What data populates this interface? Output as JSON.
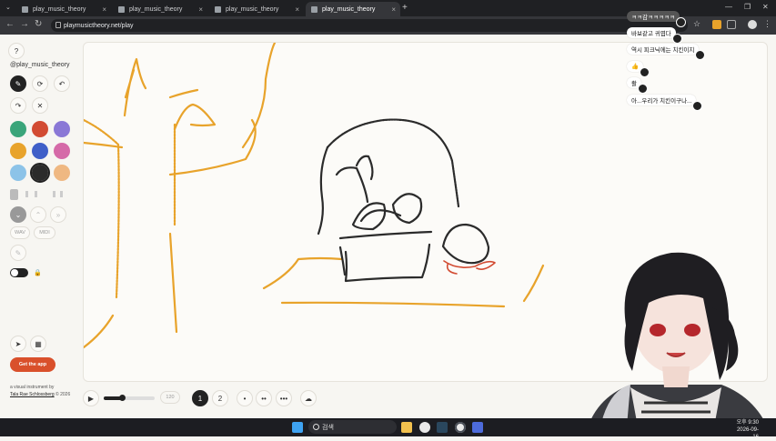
{
  "browser": {
    "tabs": [
      {
        "title": "play_music_theory"
      },
      {
        "title": "play_music_theory"
      },
      {
        "title": "play_music_theory"
      },
      {
        "title": "play_music_theory"
      }
    ],
    "url": "playmusictheory.net/play"
  },
  "sidebar": {
    "handle": "@play_music_theory",
    "help_glyph": "?",
    "tool_glyphs": {
      "pen": "✎",
      "shuffle": "⟳",
      "undo": "↶",
      "redo": "↷",
      "random": "✕"
    },
    "colors": [
      "#3aa57a",
      "#d24b32",
      "#8a78d6",
      "#e8a32b",
      "#3f5fc8",
      "#d56aa8",
      "#8cc3e8",
      "#2b2b2b",
      "#efb882"
    ],
    "selected_color": "#2b2b2b",
    "wav_label": "WAV",
    "midi_label": "MIDI",
    "get_app_label": "Get the app",
    "credit_prefix": "a visual instrument by",
    "credit_author": "Tala Rae Schlossberg",
    "credit_year": "© 2026"
  },
  "playback": {
    "tempo": "120",
    "page_1": "1",
    "page_2": "2",
    "dot1": "•",
    "dot2": "••",
    "dot3": "•••",
    "progress": 0.35
  },
  "chat": [
    {
      "text": "ㅋㅋ감ㅋㅋㅋㅋㅋ",
      "dark": true
    },
    {
      "text": "바보같고 귀엽다",
      "dark": false
    },
    {
      "text": "역시 피크닉에는 치킨이지",
      "dark": false
    },
    {
      "text": "👍",
      "dark": false
    },
    {
      "text": "촬",
      "dark": false
    },
    {
      "text": "아...우리가 치킨이구나...",
      "dark": false
    }
  ],
  "taskbar": {
    "search_label": "검색",
    "time": "오후 9:30",
    "date": "2026-09-16"
  },
  "colors": {
    "accent": "#d9502b",
    "stroke_orange": "#e8a32b",
    "stroke_black": "#2b2b2b",
    "stroke_red": "#d24b32"
  }
}
